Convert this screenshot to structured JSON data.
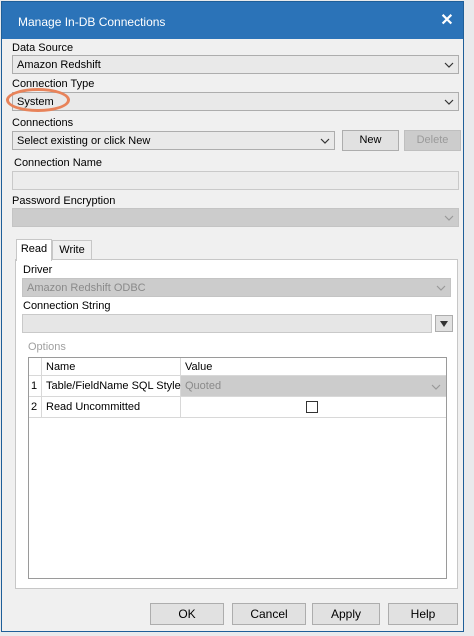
{
  "window": {
    "title": "Manage In-DB Connections",
    "close_glyph": "✕"
  },
  "data_source": {
    "label": "Data Source",
    "value": "Amazon Redshift"
  },
  "connection_type": {
    "label": "Connection Type",
    "value": "System"
  },
  "connections": {
    "label": "Connections",
    "value": "Select existing or click New",
    "new_label": "New",
    "delete_label": "Delete"
  },
  "connection_name": {
    "label": "Connection Name",
    "value": ""
  },
  "password_encryption": {
    "label": "Password Encryption",
    "value": ""
  },
  "tabs": [
    {
      "label": "Read",
      "active": true
    },
    {
      "label": "Write",
      "active": false
    }
  ],
  "read_tab": {
    "driver_label": "Driver",
    "driver_value": "Amazon Redshift ODBC",
    "connection_string_label": "Connection String",
    "connection_string_value": "",
    "options_label": "Options",
    "options_columns": [
      "Name",
      "Value"
    ],
    "options_rows": [
      {
        "num": "1",
        "name": "Table/FieldName SQL Style",
        "value": "Quoted",
        "type": "dropdown"
      },
      {
        "num": "2",
        "name": "Read Uncommitted",
        "value": "",
        "type": "checkbox",
        "checked": false
      }
    ]
  },
  "footer": {
    "ok": "OK",
    "cancel": "Cancel",
    "apply": "Apply",
    "help": "Help"
  },
  "colors": {
    "title_bar": "#2b73b8",
    "highlight_ring": "#e8835a"
  }
}
